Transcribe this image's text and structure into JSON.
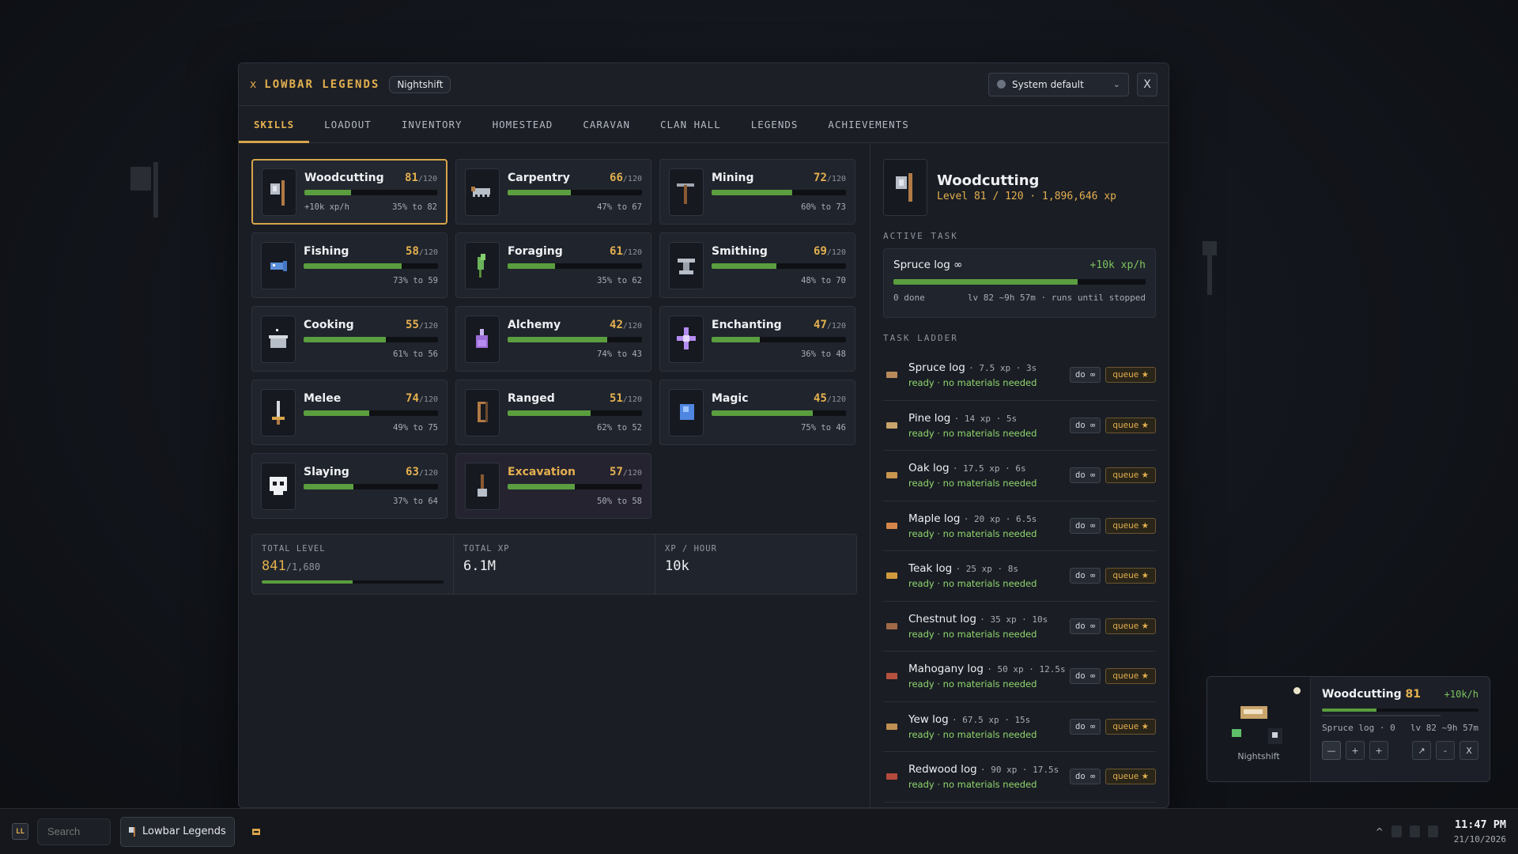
{
  "window": {
    "title": "LOWBAR LEGENDS",
    "title_icon": "x",
    "badge": "Nightshift",
    "theme_select": "System default",
    "close_label": "X"
  },
  "tabs": [
    {
      "label": "SKILLS",
      "active": true
    },
    {
      "label": "LOADOUT"
    },
    {
      "label": "INVENTORY"
    },
    {
      "label": "HOMESTEAD"
    },
    {
      "label": "CARAVAN"
    },
    {
      "label": "CLAN HALL"
    },
    {
      "label": "LEGENDS"
    },
    {
      "label": "ACHIEVEMENTS"
    }
  ],
  "skills": [
    {
      "name": "Woodcutting",
      "level": "81",
      "max": "/120",
      "progress": 0.35,
      "left": "+10k xp/h",
      "right": "35% to 82",
      "icon": "axe-icon"
    },
    {
      "name": "Carpentry",
      "level": "66",
      "max": "/120",
      "progress": 0.47,
      "left": "",
      "right": "47% to 67",
      "icon": "saw-icon"
    },
    {
      "name": "Mining",
      "level": "72",
      "max": "/120",
      "progress": 0.6,
      "left": "",
      "right": "60% to 73",
      "icon": "pickaxe-icon"
    },
    {
      "name": "Fishing",
      "level": "58",
      "max": "/120",
      "progress": 0.73,
      "left": "",
      "right": "73% to 59",
      "icon": "fish-icon"
    },
    {
      "name": "Foraging",
      "level": "61",
      "max": "/120",
      "progress": 0.35,
      "left": "",
      "right": "35% to 62",
      "icon": "leaf-icon"
    },
    {
      "name": "Smithing",
      "level": "69",
      "max": "/120",
      "progress": 0.48,
      "left": "",
      "right": "48% to 70",
      "icon": "anvil-icon"
    },
    {
      "name": "Cooking",
      "level": "55",
      "max": "/120",
      "progress": 0.61,
      "left": "",
      "right": "61% to 56",
      "icon": "pot-icon"
    },
    {
      "name": "Alchemy",
      "level": "42",
      "max": "/120",
      "progress": 0.74,
      "left": "",
      "right": "74% to 43",
      "icon": "potion-icon"
    },
    {
      "name": "Enchanting",
      "level": "47",
      "max": "/120",
      "progress": 0.36,
      "left": "",
      "right": "36% to 48",
      "icon": "sparkle-icon"
    },
    {
      "name": "Melee",
      "level": "74",
      "max": "/120",
      "progress": 0.49,
      "left": "",
      "right": "49% to 75",
      "icon": "sword-icon"
    },
    {
      "name": "Ranged",
      "level": "51",
      "max": "/120",
      "progress": 0.62,
      "left": "",
      "right": "62% to 52",
      "icon": "bow-icon"
    },
    {
      "name": "Magic",
      "level": "45",
      "max": "/120",
      "progress": 0.75,
      "left": "",
      "right": "75% to 46",
      "icon": "orb-icon"
    },
    {
      "name": "Slaying",
      "level": "63",
      "max": "/120",
      "progress": 0.37,
      "left": "",
      "right": "37% to 64",
      "icon": "skull-icon"
    },
    {
      "name": "Excavation",
      "level": "57",
      "max": "/120",
      "progress": 0.5,
      "left": "",
      "right": "50% to 58",
      "icon": "shovel-icon"
    }
  ],
  "totals": {
    "level_label": "TOTAL LEVEL",
    "level_value": "841",
    "level_max": "/1,680",
    "level_progress": 0.5,
    "xp_label": "TOTAL XP",
    "xp_value": "6.1M",
    "rate_label": "XP / HOUR",
    "rate_value": "10k"
  },
  "selected": {
    "name": "Woodcutting",
    "sub": "Level 81 / 120 · 1,896,646 xp"
  },
  "active_task": {
    "section": "ACTIVE TASK",
    "name": "Spruce log ∞",
    "rate": "+10k xp/h",
    "progress": 0.73,
    "done": "0 done",
    "eta": "lv 82 ~9h 57m · runs until stopped"
  },
  "ladder": {
    "section": "TASK LADDER",
    "do_label": "do ∞",
    "queue_label": "queue ★",
    "items": [
      {
        "name": "Spruce log",
        "meta": "· 7.5 xp · 3s",
        "status": "ready · no materials needed",
        "color": "#b88a5a"
      },
      {
        "name": "Pine log",
        "meta": "· 14 xp · 5s",
        "status": "ready · no materials needed",
        "color": "#c9a46b"
      },
      {
        "name": "Oak log",
        "meta": "· 17.5 xp · 6s",
        "status": "ready · no materials needed",
        "color": "#c7954e"
      },
      {
        "name": "Maple log",
        "meta": "· 20 xp · 6.5s",
        "status": "ready · no materials needed",
        "color": "#d4864a"
      },
      {
        "name": "Teak log",
        "meta": "· 25 xp · 8s",
        "status": "ready · no materials needed",
        "color": "#cf9a3e"
      },
      {
        "name": "Chestnut log",
        "meta": "· 35 xp · 10s",
        "status": "ready · no materials needed",
        "color": "#a06a48"
      },
      {
        "name": "Mahogany log",
        "meta": "· 50 xp · 12.5s",
        "status": "ready · no materials needed",
        "color": "#b5513e"
      },
      {
        "name": "Yew log",
        "meta": "· 67.5 xp · 15s",
        "status": "ready · no materials needed",
        "color": "#c08f52"
      },
      {
        "name": "Redwood log",
        "meta": "· 90 xp · 17.5s",
        "status": "ready · no materials needed",
        "color": "#b44a3c"
      }
    ]
  },
  "widget": {
    "caption": "Nightshift",
    "name": "Woodcutting",
    "level": "81",
    "rate": "+10k/h",
    "progress": 0.35,
    "task": "Spruce log · 0",
    "eta": "lv 82 ~9h 57m",
    "btns": [
      "—",
      "+",
      "+",
      "↗",
      "-",
      "X"
    ]
  },
  "taskbar": {
    "logo": "LL",
    "search_placeholder": "Search",
    "app_label": "Lowbar Legends",
    "tray_caret": "^",
    "time": "11:47 PM",
    "date": "21/10/2026"
  },
  "colors": {
    "accent": "#d7a54a",
    "xp_green": "#5a9e3f",
    "rate_green": "#7cc460"
  }
}
